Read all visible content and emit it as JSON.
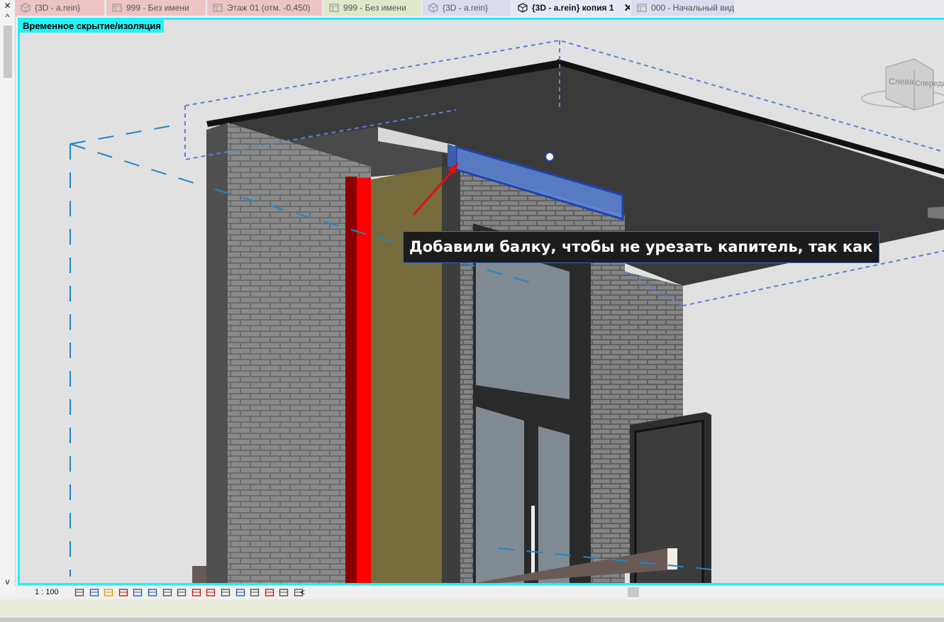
{
  "tabs": [
    {
      "label": "{3D - a.rein}",
      "icon": "3d-view-icon",
      "color": "#ecc4c4",
      "active": false
    },
    {
      "label": "999 - Без имени",
      "icon": "sheet-icon",
      "color": "#ecc4c4",
      "active": false
    },
    {
      "label": "Этаж 01 (отм. -0,450)",
      "icon": "floor-plan-icon",
      "color": "#ecc4c4",
      "active": false
    },
    {
      "label": "999 - Без имени",
      "icon": "sheet-icon",
      "color": "#dfe8c8",
      "active": false
    },
    {
      "label": "{3D - a.rein}",
      "icon": "3d-view-icon",
      "color": "#dcdcf0",
      "active": false
    },
    {
      "label": "{3D - a.rein} копия 1",
      "icon": "3d-view-icon",
      "color": "#e6e8f3",
      "active": true,
      "close": "✕"
    },
    {
      "label": "000 - Начальный вид",
      "icon": "sheet-icon",
      "color": "#dcdcf0",
      "active": false
    }
  ],
  "left_controls": {
    "close": "✕",
    "up": "^",
    "down": "v"
  },
  "viewport": {
    "mode_badge": "Временное скрытие/изоляция",
    "tooltip": "Добавили балку, чтобы не урезать капитель, так как",
    "viewcube": {
      "left": "Слева",
      "front": "Спереди"
    }
  },
  "statusbar": {
    "scale": "1 : 100",
    "icons": [
      "detail-level-icon",
      "visual-style-icon",
      "sun-path-icon",
      "shadows-icon",
      "render-icon",
      "crop-view-icon",
      "show-crop-icon",
      "unlock-3d-icon",
      "temporary-hide-icon",
      "reveal-hidden-icon",
      "lock-view-icon",
      "analytical-model-icon",
      "highlight-displacement-icon",
      "reveal-constraints-icon",
      "temporary-view-properties-icon",
      "worksharing-icon"
    ],
    "scroll_left": "<"
  },
  "colors": {
    "accent": "#1ef0f8",
    "selection": "#3a6fd6",
    "arrow": "#e01010"
  }
}
